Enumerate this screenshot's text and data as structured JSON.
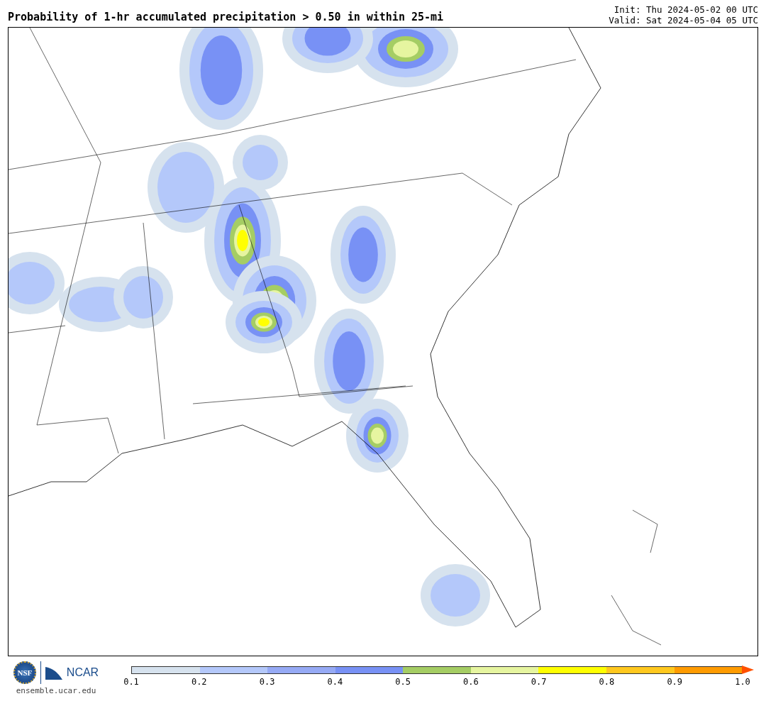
{
  "title": "Probability of 1-hr accumulated precipitation > 0.50 in within 25-mi",
  "init": "Init: Thu 2024-05-02 00 UTC",
  "valid": "Valid: Sat 2024-05-04 05 UTC",
  "logos": {
    "nsf": "NSF",
    "ncar": "NCAR",
    "url": "ensemble.ucar.edu"
  },
  "colorbar": {
    "segments": [
      {
        "kind": "band",
        "color": "#d6e2ee"
      },
      {
        "kind": "band",
        "color": "#b4c8fa"
      },
      {
        "kind": "band",
        "color": "#96aaf5"
      },
      {
        "kind": "band",
        "color": "#7891f5"
      },
      {
        "kind": "band",
        "color": "#a5cd64"
      },
      {
        "kind": "band",
        "color": "#e6f5a0"
      },
      {
        "kind": "band",
        "color": "#ffff00"
      },
      {
        "kind": "band",
        "color": "#ffc81e"
      },
      {
        "kind": "band",
        "color": "#ff9b00"
      },
      {
        "kind": "arrow",
        "color": "#ff5000"
      }
    ],
    "ticks": [
      "0.1",
      "0.2",
      "0.3",
      "0.4",
      "0.5",
      "0.6",
      "0.7",
      "0.8",
      "0.9",
      "1.0"
    ]
  }
}
